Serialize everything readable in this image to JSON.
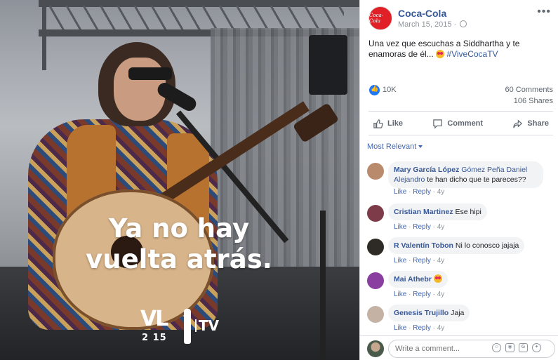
{
  "photo": {
    "overlay_line1": "Ya no hay",
    "overlay_line2": "vuelta atrás.",
    "logo_vl": "VL",
    "logo_year": "2 15",
    "logo_tv": "TV"
  },
  "post": {
    "page_name": "Coca-Cola",
    "avatar_text": "Coca-Cola",
    "date": "March 15, 2015 ·",
    "text": "Una vez que escuchas a Siddhartha y te enamoras de él... ",
    "hashtag": "#ViveCocaTV",
    "likes": "10K",
    "comments_count": "60 Comments",
    "shares_count": "106 Shares"
  },
  "actions": {
    "like": "Like",
    "comment": "Comment",
    "share": "Share"
  },
  "filter": {
    "label": "Most Relevant"
  },
  "comments": [
    {
      "author": "Mary García López",
      "tagged": "Gómez Peña Daniel Alejandro",
      "text": " te han dicho que te pareces??",
      "like": "Like",
      "reply": "Reply",
      "time": "4y",
      "avatar_color": "#b98a6c"
    },
    {
      "author": "Cristian Martinez",
      "tagged": "",
      "text": " Ese hipi",
      "like": "Like",
      "reply": "Reply",
      "time": "4y",
      "avatar_color": "#7d3b4a"
    },
    {
      "author": "R Valentín Tobon",
      "tagged": "",
      "text": " Ni lo conosco jajaja",
      "like": "Like",
      "reply": "Reply",
      "time": "4y",
      "avatar_color": "#2e2a26"
    },
    {
      "author": "Mai Athebr",
      "tagged": "",
      "text": "",
      "like": "Like",
      "reply": "Reply",
      "time": "4y",
      "avatar_color": "#8a3fa0"
    },
    {
      "author": "Genesis Trujillo",
      "tagged": "",
      "text": " Jaja",
      "like": "Like",
      "reply": "Reply",
      "time": "4y",
      "avatar_color": "#c4b2a4"
    }
  ],
  "composer": {
    "placeholder": "Write a comment..."
  },
  "colors": {
    "link": "#365899",
    "like_blue": "#2078f4",
    "brand_red": "#e01f26"
  }
}
